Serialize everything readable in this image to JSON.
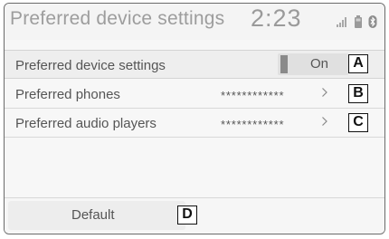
{
  "header": {
    "title": "Preferred device settings",
    "clock": "2:23",
    "icons": [
      "signal-icon",
      "battery-icon",
      "bluetooth-icon"
    ]
  },
  "rows": [
    {
      "label": "Preferred device settings",
      "toggle_value": "On",
      "callout": "A"
    },
    {
      "label": "Preferred phones",
      "value": "************",
      "chevron": ">",
      "callout": "B"
    },
    {
      "label": "Preferred audio players",
      "value": "************",
      "chevron": ">",
      "callout": "C"
    }
  ],
  "footer": {
    "default_label": "Default",
    "callout": "D"
  },
  "colors": {
    "frame_border": "#6a6a6a",
    "background": "#f7f7f7",
    "header_text": "#9d9d9d",
    "body_text": "#555555",
    "toggle_knob": "#8a8a8a",
    "callout_border": "#111111"
  }
}
